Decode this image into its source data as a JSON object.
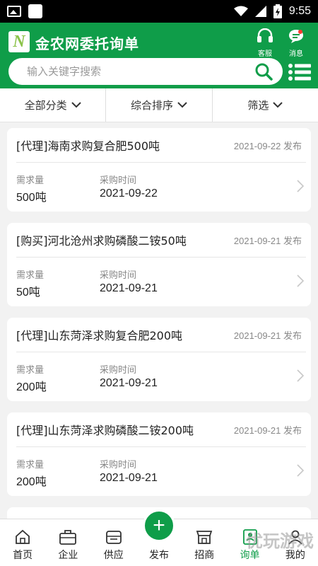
{
  "status_bar": {
    "time": "9:55"
  },
  "header": {
    "logo_letter": "N",
    "title": "金农网委托询单",
    "service_label": "客服",
    "message_label": "消息",
    "theme_color": "#0f9d49"
  },
  "search": {
    "placeholder": "输入关键字搜索"
  },
  "filters": [
    {
      "label": "全部分类"
    },
    {
      "label": "综合排序"
    },
    {
      "label": "筛选"
    }
  ],
  "list": {
    "quantity_label": "需求量",
    "time_label": "采购时间",
    "items": [
      {
        "title": "[代理]海南求购复合肥500吨",
        "published": "2021-09-22 发布",
        "quantity": "500吨",
        "purchase_time": "2021-09-22"
      },
      {
        "title": "[购买]河北沧州求购磷酸二铵50吨",
        "published": "2021-09-21 发布",
        "quantity": "50吨",
        "purchase_time": "2021-09-21"
      },
      {
        "title": "[代理]山东菏泽求购复合肥200吨",
        "published": "2021-09-21 发布",
        "quantity": "200吨",
        "purchase_time": "2021-09-21"
      },
      {
        "title": "[代理]山东菏泽求购磷酸二铵200吨",
        "published": "2021-09-21 发布",
        "quantity": "200吨",
        "purchase_time": "2021-09-21"
      }
    ]
  },
  "tabbar": [
    {
      "label": "首页",
      "icon": "home-icon"
    },
    {
      "label": "企业",
      "icon": "briefcase-icon"
    },
    {
      "label": "供应",
      "icon": "supply-icon"
    },
    {
      "label": "发布",
      "icon": "plus-icon"
    },
    {
      "label": "招商",
      "icon": "shop-icon"
    },
    {
      "label": "询单",
      "icon": "inquiry-icon",
      "active": true
    },
    {
      "label": "我的",
      "icon": "user-icon"
    }
  ],
  "watermark": "优玩游戏"
}
